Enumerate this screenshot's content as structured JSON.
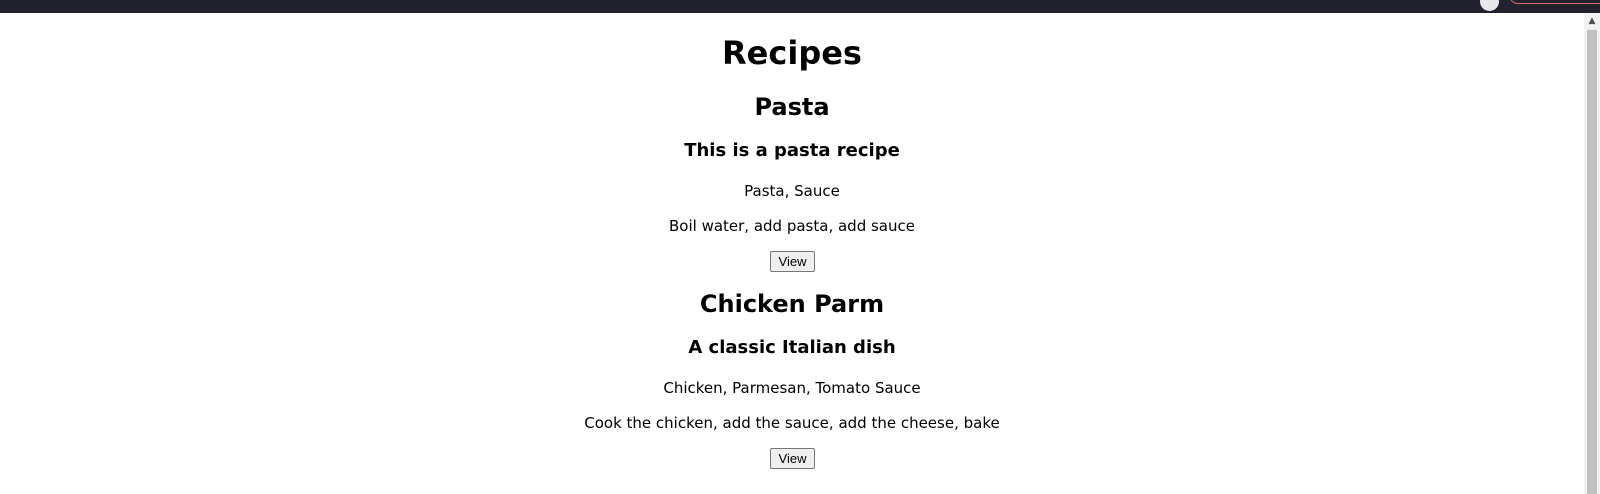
{
  "page": {
    "title": "Recipes"
  },
  "recipes": [
    {
      "name": "Pasta",
      "description": "This is a pasta recipe",
      "ingredients": "Pasta, Sauce",
      "instructions": "Boil water, add pasta, add sauce",
      "button_label": "View"
    },
    {
      "name": "Chicken Parm",
      "description": "A classic Italian dish",
      "ingredients": "Chicken, Parmesan, Tomato Sauce",
      "instructions": "Cook the chicken, add the sauce, add the cheese, bake",
      "button_label": "View"
    }
  ],
  "scrollbar": {
    "up_arrow": "▲"
  },
  "colors": {
    "topbar": "#22222e",
    "topbar_button_border": "#e06a6a"
  }
}
